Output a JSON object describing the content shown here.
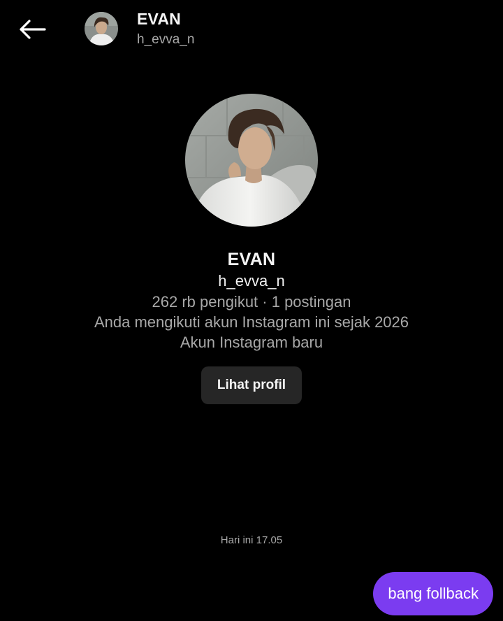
{
  "header": {
    "name": "EVAN",
    "username": "h_evva_n",
    "back_icon": "arrow-left-icon"
  },
  "profile": {
    "name": "EVAN",
    "username": "h_evva_n",
    "stats": "262 rb pengikut · 1 postingan",
    "follow_since": "Anda mengikuti akun Instagram ini sejak 2026",
    "account_note": "Akun Instagram baru",
    "view_profile_label": "Lihat profil"
  },
  "conversation": {
    "timestamp": "Hari ini 17.05",
    "messages": [
      {
        "text": "bang follback",
        "from": "me"
      }
    ]
  },
  "colors": {
    "background": "#000000",
    "bubble": "#7b3cf0",
    "button": "#262626",
    "muted_text": "#a8a8a8"
  }
}
